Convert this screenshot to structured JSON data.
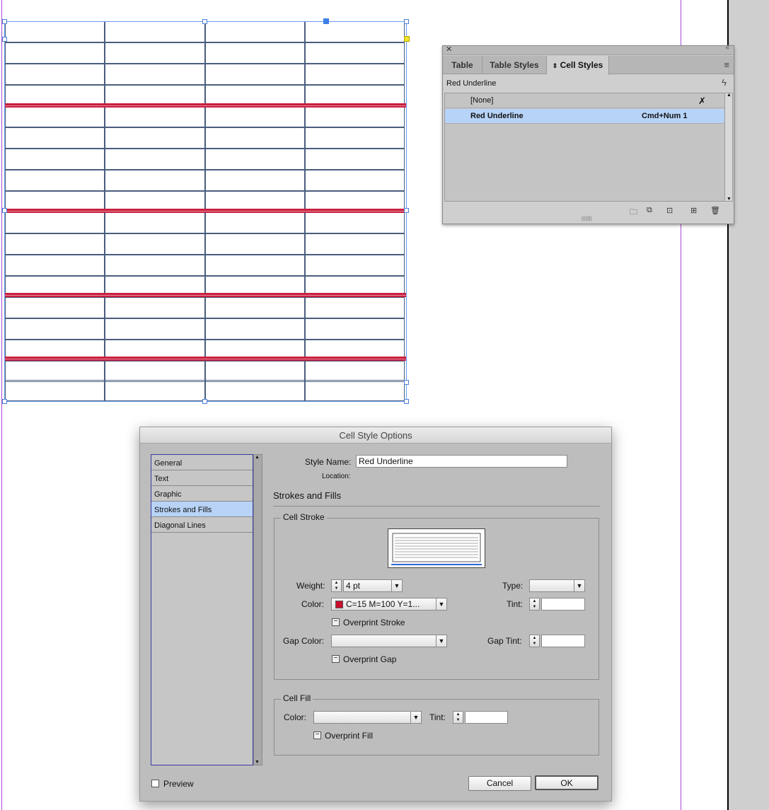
{
  "panel": {
    "tabs": [
      "Table",
      "Table Styles",
      "Cell Styles"
    ],
    "active_tab": "Cell Styles",
    "current_style": "Red Underline",
    "items": [
      {
        "name": "[None]",
        "shortcut": ""
      },
      {
        "name": "Red Underline",
        "shortcut": "Cmd+Num 1"
      }
    ],
    "selected_item": "Red Underline"
  },
  "dialog": {
    "title": "Cell Style Options",
    "categories": [
      "General",
      "Text",
      "Graphic",
      "Strokes and Fills",
      "Diagonal Lines"
    ],
    "selected_category": "Strokes and Fills",
    "style_name_label": "Style Name:",
    "style_name_value": "Red Underline",
    "location_label": "Location:",
    "section_title": "Strokes and Fills",
    "cell_stroke": {
      "legend": "Cell Stroke",
      "weight_label": "Weight:",
      "weight_value": "4 pt",
      "type_label": "Type:",
      "type_value": "",
      "color_label": "Color:",
      "color_value": "C=15 M=100 Y=1...",
      "color_swatch": "#c8102e",
      "tint_label": "Tint:",
      "tint_value": "",
      "overprint_stroke": "Overprint Stroke",
      "gap_color_label": "Gap Color:",
      "gap_color_value": "",
      "gap_tint_label": "Gap Tint:",
      "gap_tint_value": "",
      "overprint_gap": "Overprint Gap"
    },
    "cell_fill": {
      "legend": "Cell Fill",
      "color_label": "Color:",
      "color_value": "",
      "tint_label": "Tint:",
      "tint_value": "",
      "overprint_fill": "Overprint Fill"
    },
    "preview_label": "Preview",
    "preview_checked": false,
    "cancel_label": "Cancel",
    "ok_label": "OK"
  },
  "colors": {
    "stroke_red": "#c8203f",
    "selection_blue": "#b8d3f6",
    "table_line": "#4a5d7e"
  }
}
